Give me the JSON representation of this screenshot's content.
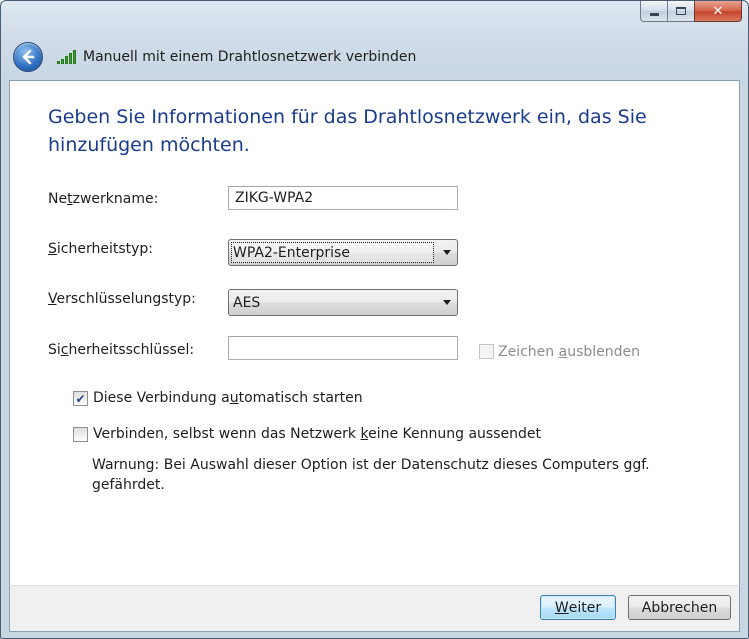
{
  "window": {
    "title": "Manuell mit einem Drahtlosnetzwerk verbinden",
    "caption": {
      "minimize": "",
      "maximize": "",
      "close": "✕"
    }
  },
  "icons": {
    "back": "back-arrow-icon",
    "wifi": "wireless-signal-icon",
    "check": "checkmark-icon"
  },
  "colors": {
    "heading": "#1a3c8c",
    "accent": "#2f6fc0",
    "close": "#c4442a"
  },
  "heading": "Geben Sie Informationen für das Drahtlosnetzwerk ein, das Sie hinzufügen möchten.",
  "form": {
    "network_name": {
      "label_pre": "Ne",
      "label_key": "t",
      "label_post": "zwerkname:",
      "value": "ZIKG-WPA2"
    },
    "security_type": {
      "label_pre": "",
      "label_key": "S",
      "label_post": "icherheitstyp:",
      "selected": "WPA2-Enterprise"
    },
    "encryption_type": {
      "label_pre": "",
      "label_key": "V",
      "label_post": "erschlüsselungstyp:",
      "selected": "AES"
    },
    "security_key": {
      "label_pre": "Si",
      "label_key": "c",
      "label_post": "herheitsschlüssel:",
      "value": ""
    },
    "hide_chars": {
      "label_pre": "Zeichen ",
      "label_key": "a",
      "label_post": "usblenden",
      "checked": false,
      "disabled": true
    },
    "auto_start": {
      "label_pre": "Diese Verbindung a",
      "label_key": "u",
      "label_post": "tomatisch starten",
      "checked": true
    },
    "connect_hidden": {
      "label_pre": "Verbinden, selbst wenn das Netzwerk ",
      "label_key": "k",
      "label_post": "eine Kennung aussendet",
      "checked": false
    }
  },
  "warning": "Warnung: Bei Auswahl dieser Option ist der Datenschutz dieses Computers ggf. gefährdet.",
  "buttons": {
    "next": {
      "label_pre": "",
      "label_key": "W",
      "label_post": "eiter"
    },
    "cancel": {
      "label": "Abbrechen"
    }
  }
}
